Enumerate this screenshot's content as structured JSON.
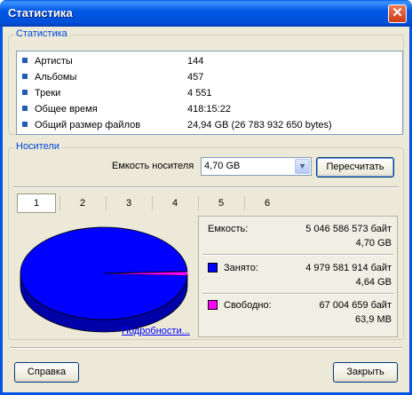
{
  "window": {
    "title": "Статистика",
    "close_glyph": "✕"
  },
  "stats": {
    "legend": "Статистика",
    "rows": [
      {
        "label": "Артисты",
        "value": "144"
      },
      {
        "label": "Альбомы",
        "value": "457"
      },
      {
        "label": "Треки",
        "value": "4 551"
      },
      {
        "label": "Общее время",
        "value": "418:15:22"
      },
      {
        "label": "Общий размер файлов",
        "value": "24,94 GB (26 783 932 650 bytes)"
      }
    ]
  },
  "media": {
    "legend": "Носители",
    "capacity_label": "Емкость носителя",
    "capacity_value": "4,70 GB",
    "recalc_label": "Пересчитать",
    "tabs": [
      "1",
      "2",
      "3",
      "4",
      "5",
      "6"
    ],
    "selected_tab": "1",
    "details_link": "Подробности...",
    "info": {
      "capacity_label": "Емкость:",
      "capacity_bytes": "5 046 586 573 байт",
      "capacity_human": "4,70 GB",
      "used_label": "Занято:",
      "used_bytes": "4 979 581 914 байт",
      "used_human": "4,64 GB",
      "free_label": "Свободно:",
      "free_bytes": "67 004 659 байт",
      "free_human": "63,9 MB"
    },
    "pie": {
      "used_fraction": 0.9867,
      "free_fraction": 0.0133,
      "used_color": "#0000ff",
      "free_color": "#ff00ff"
    }
  },
  "footer": {
    "help_label": "Справка",
    "close_label": "Закрыть"
  }
}
